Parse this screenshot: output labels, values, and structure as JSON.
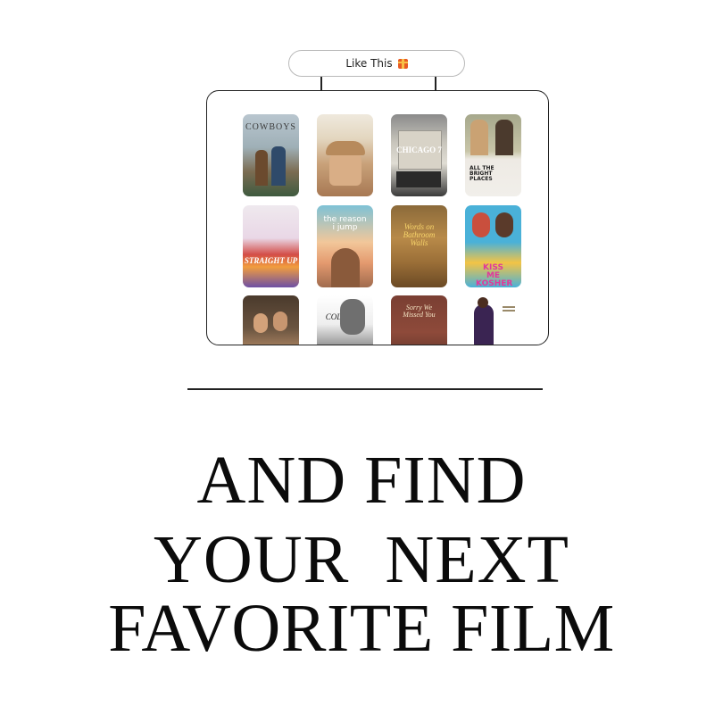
{
  "pill": {
    "label": "Like This",
    "icon": "gift-icon"
  },
  "posters": [
    {
      "title": "COWBOYS",
      "icon": "movie-poster-cowboys"
    },
    {
      "title": "",
      "icon": "movie-poster-portrait"
    },
    {
      "title": "CHICAGO 7",
      "icon": "movie-poster-chicago-7"
    },
    {
      "title": "ALL THE BRIGHT PLACES",
      "icon": "movie-poster-all-the-bright-places"
    },
    {
      "title": "STRAIGHT UP",
      "icon": "movie-poster-straight-up"
    },
    {
      "title": "the reason i jump",
      "icon": "movie-poster-the-reason-i-jump"
    },
    {
      "title": "Words on Bathroom Walls",
      "icon": "movie-poster-words-on-bathroom-walls"
    },
    {
      "title": "KISS ME KOSHER",
      "icon": "movie-poster-kiss-me-kosher"
    },
    {
      "title": "",
      "icon": "movie-poster-couple"
    },
    {
      "title": "COLOSSAL",
      "icon": "movie-poster-colossal"
    },
    {
      "title": "Sorry We Missed You",
      "icon": "movie-poster-sorry-we-missed-you"
    },
    {
      "title": "",
      "icon": "movie-poster-dancer"
    }
  ],
  "headline": {
    "line1": "AND FIND",
    "line2": "YOUR  NEXT",
    "line3": "FAVORITE FILM"
  }
}
